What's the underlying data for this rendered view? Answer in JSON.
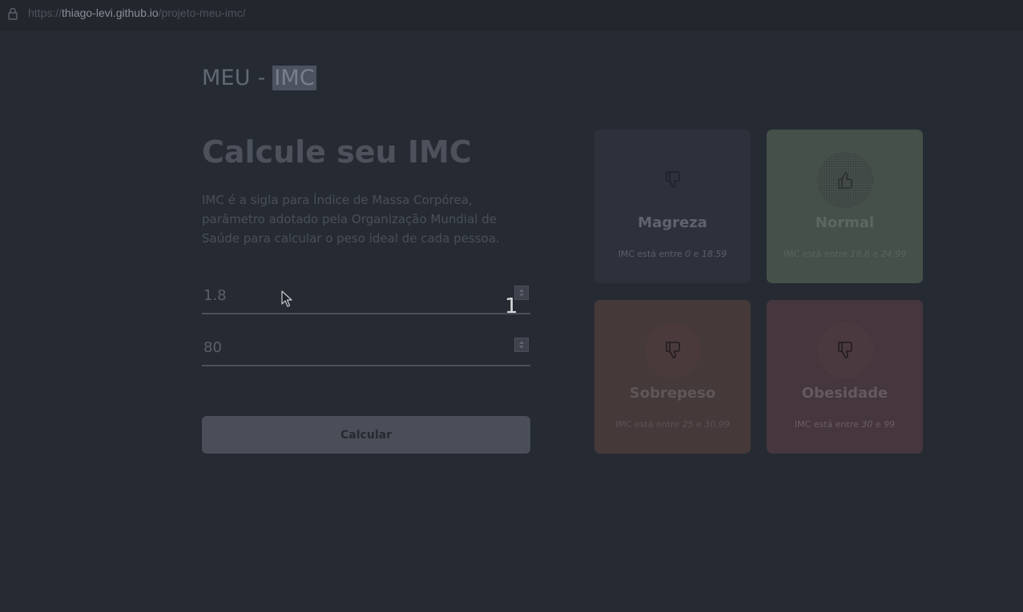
{
  "browser": {
    "url_scheme": "https://",
    "url_host": "thiago-levi.github.io",
    "url_path": "/projeto-meu-imc/"
  },
  "logo": {
    "text": "MEU - ",
    "highlight": "IMC"
  },
  "hero": {
    "title": "Calcule seu IMC",
    "description": "IMC é a sigla para Índice de Massa Corpórea, parâmetro adotado pela Organização Mundial de Saúde para calcular o peso ideal de cada pessoa."
  },
  "form": {
    "height_value": "1.8",
    "weight_value": "80",
    "submit_label": "Calcular",
    "overlay_digit": "1"
  },
  "cards": [
    {
      "name": "Magreza",
      "prefix": "IMC está entre ",
      "min": "0",
      "sep": " e ",
      "max": "18.59",
      "icon": "thumbs-down-icon",
      "color": "#2d313c"
    },
    {
      "name": "Normal",
      "prefix": "IMC está entre ",
      "min": "18.6",
      "sep": " e ",
      "max": "24.99",
      "icon": "thumbs-up-icon",
      "color": "#46504a"
    },
    {
      "name": "Sobrepeso",
      "prefix": "IMC está entre ",
      "min": "25",
      "sep": " e ",
      "max": "30.99",
      "icon": "thumbs-down-icon",
      "color": "#45393a"
    },
    {
      "name": "Obesidade",
      "prefix": "IMC está entre ",
      "min": "30",
      "sep": " e ",
      "max": "99",
      "icon": "thumbs-down-icon",
      "color": "#46363d"
    }
  ]
}
